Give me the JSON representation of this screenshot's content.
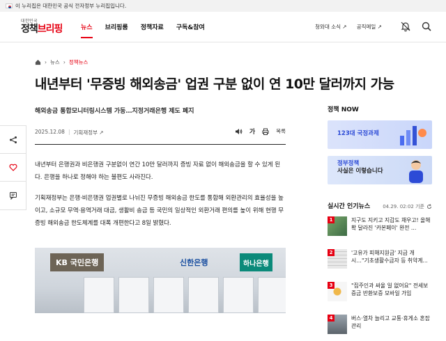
{
  "gov_bar": {
    "text": "이 누리집은 대한민국 공식 전자정부 누리집입니다."
  },
  "logo": {
    "small": "대한민국",
    "main_a": "정책",
    "main_b": "브리핑"
  },
  "nav": [
    "뉴스",
    "브리핑룸",
    "정책자료",
    "구독&참여"
  ],
  "util": [
    "청와대 소식 ↗",
    "공직메일 ↗"
  ],
  "breadcrumb": {
    "level1": "뉴스",
    "level2": "정책뉴스"
  },
  "article": {
    "title": "내년부터 '무증빙 해외송금' 업권 구분 없이 연 10만 달러까지 가능",
    "subtitle": "해외송금 통합모니터링시스템 가동…지정거래은행 제도 폐지",
    "date": "2025.12.08",
    "ministry": "기획재정부 ↗",
    "font_label": "가",
    "list_label": "목록",
    "para1": "내년부터 은행권과 비은행권 구분없이 연간 10만 달러까지 증빙 자료 없이 해외송금을 할 수 있게 된다. 은행을 하나로 정해야 하는 불편도 사라진다.",
    "para2": "기획재정부는 은행·비은행권 업권별로 나뉘진 무증빙 해외송금 한도를 통합해 외환관리의 효율성을 높이고, 소규모 무역·용역거래 대금, 생활비 송금 등 국민의 일상적인 외환거래 편의를 높이 위해 현행 무증빙 해외송금 한도체계를 대폭 개편한다고 8일 밝혔다.",
    "photo_signs": {
      "kb": "KB 국민은행",
      "shinhan": "신한은행",
      "hana": "하나은행"
    }
  },
  "sidebar": {
    "policy_now_title": "정책 NOW",
    "banner1": "123대 국정과제",
    "banner2_a": "정부정책",
    "banner2_b": "사실은 이렇습니다",
    "trending_title": "실시간 인기뉴스",
    "trending_time": "04.29. 02:02 기준",
    "items": [
      {
        "num": "1",
        "text": "지구도 지키고 지갑도 채우고! 올해 확 달라진 '카본페이' 완전 ..."
      },
      {
        "num": "2",
        "text": "'고유가 피해지원금' 지급 개시…\"기초생활수급자 등 취약계..."
      },
      {
        "num": "3",
        "text": "\"집주인과 싸울 일 없어요\" 전세보증금 반환보증 모바일 가입"
      },
      {
        "num": "4",
        "text": "버스·열차 늘리고 교통·휴게소 혼잡 관리"
      }
    ]
  }
}
